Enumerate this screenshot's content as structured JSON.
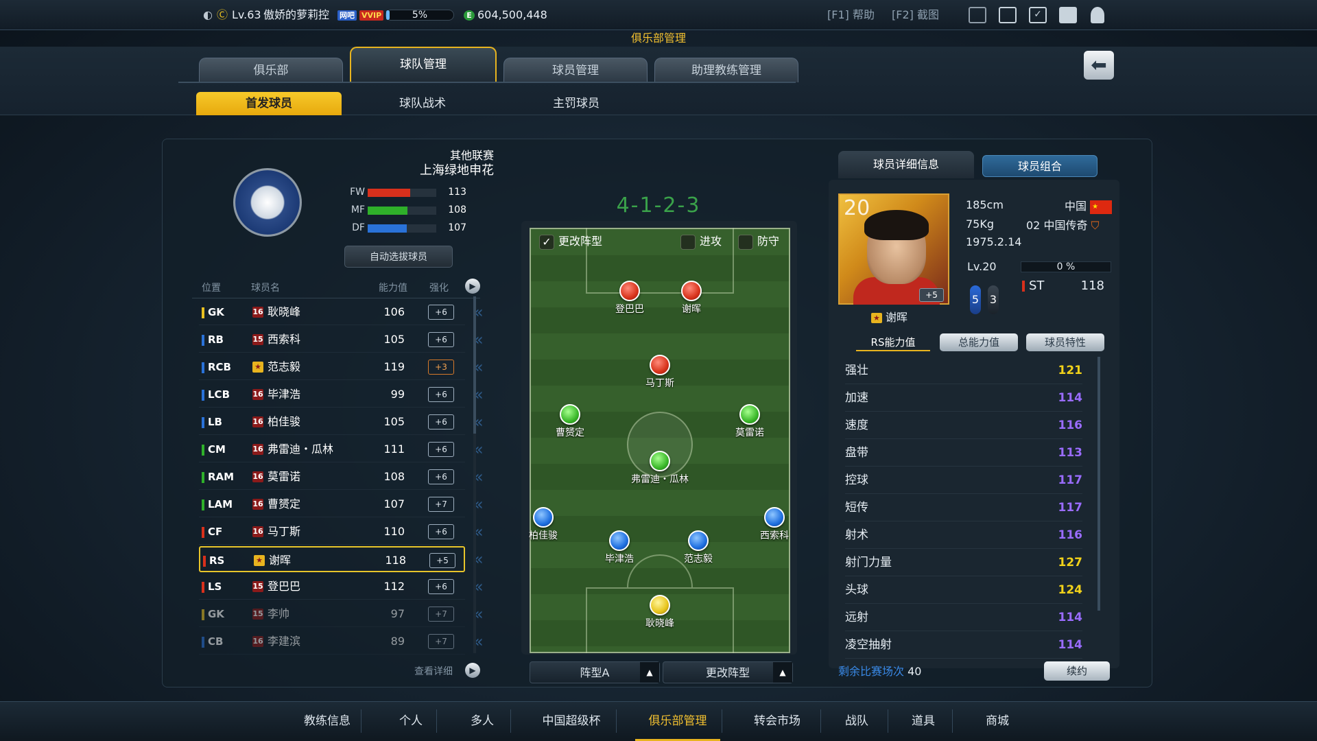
{
  "topbar": {
    "level": "Lv.63",
    "player_name": "傲娇的萝莉控",
    "badge_a": "网吧",
    "badge_vip": "VVIP",
    "exp_percent": "5%",
    "exp_fraction": 0.05,
    "coin_icon": "E",
    "coins": "604,500,448",
    "help": "[F1] 帮助",
    "screenshot": "[F2] 截图",
    "icons": [
      "mail-icon",
      "roster-icon",
      "checklist-icon",
      "chat-icon",
      "profile-icon"
    ]
  },
  "header": {
    "section_title": "俱乐部管理",
    "tabs": [
      {
        "label": "俱乐部"
      },
      {
        "label": "球队管理"
      },
      {
        "label": "球员管理"
      },
      {
        "label": "助理教练管理"
      }
    ],
    "subtabs": [
      {
        "label": "首发球员"
      },
      {
        "label": "球队战术"
      },
      {
        "label": "主罚球员"
      }
    ],
    "back_icon": "arrow-left-icon"
  },
  "club": {
    "league": "其他联赛",
    "name": "上海绿地申花",
    "stats": [
      {
        "label": "FW",
        "value": "113",
        "fill": 0.62,
        "color": "#d8301c"
      },
      {
        "label": "MF",
        "value": "108",
        "fill": 0.58,
        "color": "#2fb02a"
      },
      {
        "label": "DF",
        "value": "107",
        "fill": 0.57,
        "color": "#2a72d8"
      }
    ],
    "auto_select": "自动选拔球员"
  },
  "roster": {
    "headers": {
      "pos": "位置",
      "name": "球员名",
      "ability": "能力值",
      "enhance": "强化"
    },
    "rows": [
      {
        "pos": "GK",
        "color": "#e8c020",
        "lvl": "16",
        "star": false,
        "name": "耿晓峰",
        "value": "106",
        "plus": "+6"
      },
      {
        "pos": "RB",
        "color": "#2a72d8",
        "lvl": "15",
        "star": false,
        "name": "西索科",
        "value": "105",
        "plus": "+6"
      },
      {
        "pos": "RCB",
        "color": "#2a72d8",
        "lvl": "★",
        "star": true,
        "name": "范志毅",
        "value": "119",
        "plus": "+3"
      },
      {
        "pos": "LCB",
        "color": "#2a72d8",
        "lvl": "16",
        "star": false,
        "name": "毕津浩",
        "value": "99",
        "plus": "+6"
      },
      {
        "pos": "LB",
        "color": "#2a72d8",
        "lvl": "16",
        "star": false,
        "name": "柏佳骏",
        "value": "105",
        "plus": "+6"
      },
      {
        "pos": "CM",
        "color": "#2fb02a",
        "lvl": "16",
        "star": false,
        "name": "弗雷迪・瓜林",
        "value": "111",
        "plus": "+6"
      },
      {
        "pos": "RAM",
        "color": "#2fb02a",
        "lvl": "16",
        "star": false,
        "name": "莫雷诺",
        "value": "108",
        "plus": "+6"
      },
      {
        "pos": "LAM",
        "color": "#2fb02a",
        "lvl": "16",
        "star": false,
        "name": "曹赟定",
        "value": "107",
        "plus": "+7"
      },
      {
        "pos": "CF",
        "color": "#d8301c",
        "lvl": "16",
        "star": false,
        "name": "马丁斯",
        "value": "110",
        "plus": "+6"
      },
      {
        "pos": "RS",
        "color": "#d8301c",
        "lvl": "★",
        "star": true,
        "name": "谢晖",
        "value": "118",
        "plus": "+5"
      },
      {
        "pos": "LS",
        "color": "#d8301c",
        "lvl": "15",
        "star": false,
        "name": "登巴巴",
        "value": "112",
        "plus": "+6"
      },
      {
        "pos": "GK",
        "color": "#e8c020",
        "lvl": "15",
        "star": false,
        "name": "李帅",
        "value": "97",
        "plus": "+7"
      },
      {
        "pos": "CB",
        "color": "#2a72d8",
        "lvl": "16",
        "star": false,
        "name": "李建滨",
        "value": "89",
        "plus": "+7"
      }
    ],
    "view_detail": "查看详细"
  },
  "pitch": {
    "formation": "4-1-2-3",
    "change_formation": "更改阵型",
    "attack": "进攻",
    "defend": "防守",
    "players": [
      {
        "name": "登巴巴",
        "color": "red"
      },
      {
        "name": "谢晖",
        "color": "red"
      },
      {
        "name": "马丁斯",
        "color": "red"
      },
      {
        "name": "曹赟定",
        "color": "green"
      },
      {
        "name": "莫雷诺",
        "color": "green"
      },
      {
        "name": "弗雷迪・瓜林",
        "color": "green"
      },
      {
        "name": "柏佳骏",
        "color": "blue"
      },
      {
        "name": "西索科",
        "color": "blue"
      },
      {
        "name": "毕津浩",
        "color": "blue"
      },
      {
        "name": "范志毅",
        "color": "blue"
      },
      {
        "name": "耿晓峰",
        "color": "yellow"
      }
    ],
    "formation_select": "阵型A",
    "change_select": "更改阵型"
  },
  "detail": {
    "tab_info": "球员详细信息",
    "tab_combo": "球员组合",
    "overall": "20",
    "plus": "+5",
    "height": "185cm",
    "weight": "75Kg",
    "birth": "1975.2.14",
    "nation": "中国",
    "season": "02 中国传奇",
    "level": "Lv.20",
    "exp": "0 %",
    "position": "ST",
    "position_value": "118",
    "weak_foot": "5",
    "skill": "3",
    "name": "谢晖",
    "subtabs": [
      "RS能力值",
      "总能力值",
      "球员特性"
    ],
    "attributes": [
      {
        "name": "强壮",
        "value": "121",
        "color": "#f2d21a"
      },
      {
        "name": "加速",
        "value": "114",
        "color": "#9a6cff"
      },
      {
        "name": "速度",
        "value": "116",
        "color": "#9a6cff"
      },
      {
        "name": "盘带",
        "value": "113",
        "color": "#9a6cff"
      },
      {
        "name": "控球",
        "value": "117",
        "color": "#9a6cff"
      },
      {
        "name": "短传",
        "value": "117",
        "color": "#9a6cff"
      },
      {
        "name": "射术",
        "value": "116",
        "color": "#9a6cff"
      },
      {
        "name": "射门力量",
        "value": "127",
        "color": "#f2d21a"
      },
      {
        "name": "头球",
        "value": "124",
        "color": "#f2d21a"
      },
      {
        "name": "远射",
        "value": "114",
        "color": "#9a6cff"
      },
      {
        "name": "凌空抽射",
        "value": "114",
        "color": "#9a6cff"
      }
    ],
    "remaining_label": "剩余比赛场次",
    "remaining_value": "40",
    "renew": "续约"
  },
  "bottom_nav": [
    "教练信息",
    "个人",
    "多人",
    "中国超级杯",
    "俱乐部管理",
    "转会市场",
    "战队",
    "道具",
    "商城"
  ]
}
